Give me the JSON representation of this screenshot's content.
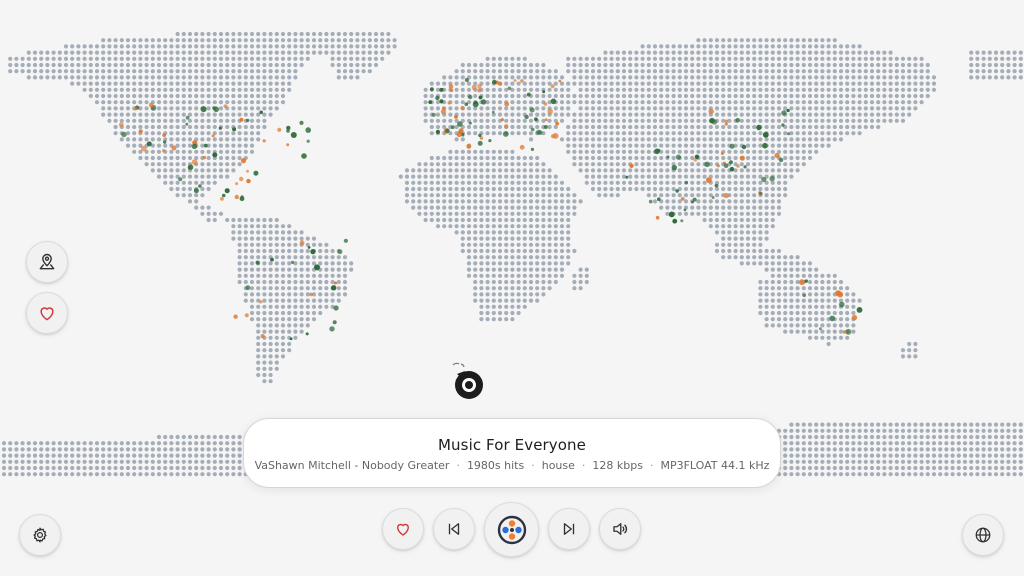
{
  "now_playing": {
    "station_name": "Music For Everyone",
    "track": "VaShawn Mitchell - Nobody Greater",
    "tags": "1980s hits",
    "genre": "house",
    "bitrate": "128 kbps",
    "codec": "MP3FLOAT 44.1 kHz"
  },
  "side_buttons": [
    {
      "icon": "map-pin-icon"
    },
    {
      "icon": "heart-icon"
    }
  ],
  "player_controls": [
    {
      "icon": "heart-icon",
      "action": "favorite"
    },
    {
      "icon": "skip-previous-icon",
      "action": "previous"
    },
    {
      "icon": "radio-logo-icon",
      "action": "play"
    },
    {
      "icon": "skip-next-icon",
      "action": "next"
    },
    {
      "icon": "volume-icon",
      "action": "volume"
    }
  ],
  "corner_buttons": [
    {
      "icon": "settings-gear-icon"
    },
    {
      "icon": "globe-icon"
    }
  ],
  "colors": {
    "background": "#f5f5f5",
    "map_dot": "#a4adb8",
    "station_green": "#2e6b3a",
    "station_orange": "#e07a30",
    "heart_red": "#d23b3b"
  }
}
